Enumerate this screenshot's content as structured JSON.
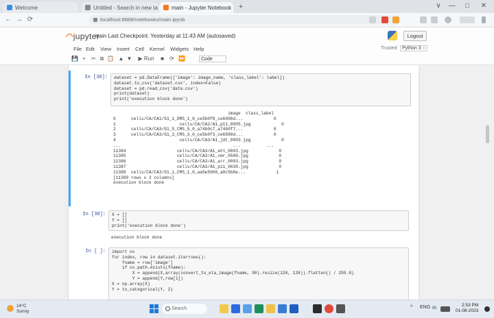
{
  "browser": {
    "tabs": [
      {
        "label": "Welcome",
        "color": "#3a8ee6"
      },
      {
        "label": "Untitled - Search in new tab",
        "color": "#8a8a8a"
      },
      {
        "label": "main - Jupyter Notebook",
        "color": "#f37726"
      }
    ],
    "new_tab": "+",
    "window_controls": [
      "∨",
      "—",
      "□",
      "✕"
    ],
    "nav": [
      "←",
      "→",
      "⟳"
    ],
    "address": "localhost:8888/notebooks/main.ipynb"
  },
  "jupyter": {
    "logo": "jupyter",
    "notebook_title": "main  Last Checkpoint: Yesterday at 11:43 AM  (autosaved)",
    "logout_label": "Logout",
    "menu": [
      "File",
      "Edit",
      "View",
      "Insert",
      "Cell",
      "Kernel",
      "Widgets",
      "Help"
    ],
    "trusted": "Trusted",
    "kernel": "Python 3 ○",
    "toolbar": [
      "💾",
      "+",
      "✂",
      "⧉",
      "📋",
      "▲",
      "▼",
      "▶ Run",
      "■",
      "⟳",
      "⏩"
    ],
    "cell_type": "Code"
  },
  "cells": [
    {
      "prompt": "In [30]:",
      "code": [
        "dataset = pd.DataFrame({'image': image_name, 'class_label': label})",
        "dataset.to_csv('dataset.csv', index=False)",
        "dataset = pd.read_csv('data.csv')",
        "print(dataset)",
        "print('execution block done')"
      ],
      "output": [
        "                                             image  class_label",
        "0      cells/CA/CA1/G1_1_DMS_1_0_ce5b0f8_ce6990d...            0",
        "1                         cells/CA/CA2/A1_p11_0005.jpg            0",
        "2      cells/CA/CA3/G1_5_CMS_5_0_a74b0c7_a74b0f7...            0",
        "3      cells/CA/CA3/G1_3_CMS_3_0_ce5b0f3_ce6990d...            0",
        "4                         cells/CA/CA3/A1_jdt_0003.jpg            0",
        "...                                            ...          ...",
        "11384                    cells/CA/CA3/A1_ehl_0003.jpg            0",
        "11385                    cells/CA/CA3/A1_cmr_0500.jpg            0",
        "11386                    cells/CA/CA3/A1_arr_0003.jpg            0",
        "11387                    cells/CA/CA3/A1_p11_0039.jpg            0",
        "11388  cells/CA/CA3/G1_1_CMS_1_0_aa5e5006_a0c5b8e...            1",
        "",
        "[11389 rows x 2 columns]",
        "execution block done"
      ]
    },
    {
      "prompt": "In [38]:",
      "code": [
        "X = []",
        "Y = []",
        "print('execution block done')"
      ],
      "output": [
        "execution block done"
      ]
    },
    {
      "prompt": "In [ ]:",
      "code": [
        "import os",
        "for index, row in dataset.iterrows():",
        "    fname = row['image']",
        "    if os.path.exists(fname):",
        "        X = append(X,array(convert_to_ela_image(fname, 90).resize(128, 128)).flatten() / 255.0)",
        "        Y = append(Y,row[1])",
        "",
        "X = np.array(X)",
        "Y = to_categorical(Y, 2)"
      ],
      "output": []
    }
  ],
  "taskbar": {
    "weather_temp": "14°C",
    "weather_desc": "Sunny",
    "search_placeholder": "Search",
    "tray": [
      "^",
      "ENG",
      "IN"
    ],
    "time": "2:53 PM",
    "date": "01-08-2023"
  }
}
